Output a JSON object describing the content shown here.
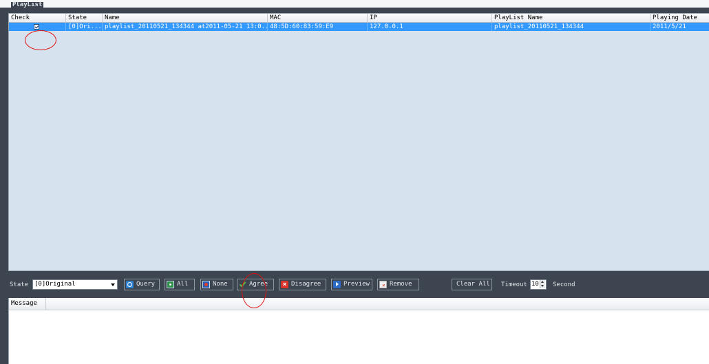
{
  "playlist": {
    "title": "PlayList",
    "columns": [
      "Check",
      "State",
      "Name",
      "MAC",
      "IP",
      "PlayList Name",
      "Playing Date"
    ],
    "rows": [
      {
        "checked": true,
        "state": "[0]Ori...",
        "name": "playlist_20110521_134344 at2011-05-21 13:0...",
        "mac": "48:5D:60:83:59:E9",
        "ip": "127.0.0.1",
        "playlist_name": "playlist_20110521_134344",
        "playing_date": "2011/5/21"
      }
    ]
  },
  "toolbar": {
    "state_label": "State",
    "state_value": "[0]Original",
    "query": "Query",
    "all": "All",
    "none": "None",
    "agree": "Agree",
    "disagree": "Disagree",
    "preview": "Preview",
    "remove": "Remove",
    "clear_all": "Clear All",
    "timeout_label": "Timeout",
    "timeout_value": "10",
    "second_label": "Second"
  },
  "message_panel": {
    "column": "Message"
  },
  "colors": {
    "selection": "#3399ff",
    "grid_background": "#d6e3ee",
    "frame": "#3d4650",
    "annotation": "#e01010"
  }
}
